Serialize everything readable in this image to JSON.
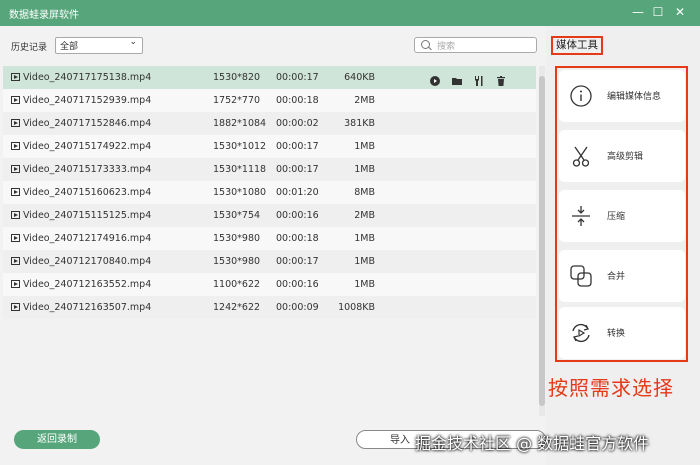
{
  "app": {
    "title": "数据蛙录屏软件"
  },
  "window_controls": [
    {
      "name": "minimize",
      "glyph": "—"
    },
    {
      "name": "maximize",
      "glyph": "☐"
    },
    {
      "name": "close",
      "glyph": "✕"
    }
  ],
  "filter": {
    "label": "历史记录",
    "selected": "全部"
  },
  "search": {
    "placeholder": "搜索"
  },
  "files": [
    {
      "name": "Video_240717175138.mp4",
      "resolution": "1530*820",
      "duration": "00:00:17",
      "size": "640KB"
    },
    {
      "name": "Video_240717152939.mp4",
      "resolution": "1752*770",
      "duration": "00:00:18",
      "size": "2MB"
    },
    {
      "name": "Video_240717152846.mp4",
      "resolution": "1882*1084",
      "duration": "00:00:02",
      "size": "381KB"
    },
    {
      "name": "Video_240715174922.mp4",
      "resolution": "1530*1012",
      "duration": "00:00:17",
      "size": "1MB"
    },
    {
      "name": "Video_240715173333.mp4",
      "resolution": "1530*1118",
      "duration": "00:00:17",
      "size": "1MB"
    },
    {
      "name": "Video_240715160623.mp4",
      "resolution": "1530*1080",
      "duration": "00:01:20",
      "size": "8MB"
    },
    {
      "name": "Video_240715115125.mp4",
      "resolution": "1530*754",
      "duration": "00:00:16",
      "size": "2MB"
    },
    {
      "name": "Video_240712174916.mp4",
      "resolution": "1530*980",
      "duration": "00:00:18",
      "size": "1MB"
    },
    {
      "name": "Video_240712170840.mp4",
      "resolution": "1530*980",
      "duration": "00:00:17",
      "size": "1MB"
    },
    {
      "name": "Video_240712163552.mp4",
      "resolution": "1100*622",
      "duration": "00:00:16",
      "size": "1MB"
    },
    {
      "name": "Video_240712163507.mp4",
      "resolution": "1242*622",
      "duration": "00:00:09",
      "size": "1008KB"
    }
  ],
  "row_actions": [
    "play-icon",
    "folder-icon",
    "tool-icon",
    "trash-icon"
  ],
  "buttons": {
    "back": "返回录制",
    "import": "导入"
  },
  "media_tools": {
    "title": "媒体工具",
    "items": [
      {
        "label": "编辑媒体信息",
        "icon": "info-icon"
      },
      {
        "label": "高级剪辑",
        "icon": "scissors-icon"
      },
      {
        "label": "压缩",
        "icon": "compress-icon"
      },
      {
        "label": "合并",
        "icon": "merge-icon"
      },
      {
        "label": "转换",
        "icon": "convert-icon"
      }
    ]
  },
  "annotation": "按照需求选择",
  "watermark": "掘金技术社区 @ 数据蛙官方软件",
  "colors": {
    "titlebar": "#57a57b",
    "selected_row": "#cfe5d9",
    "annotation_red": "#e53918",
    "primary_button": "#57a57b"
  }
}
